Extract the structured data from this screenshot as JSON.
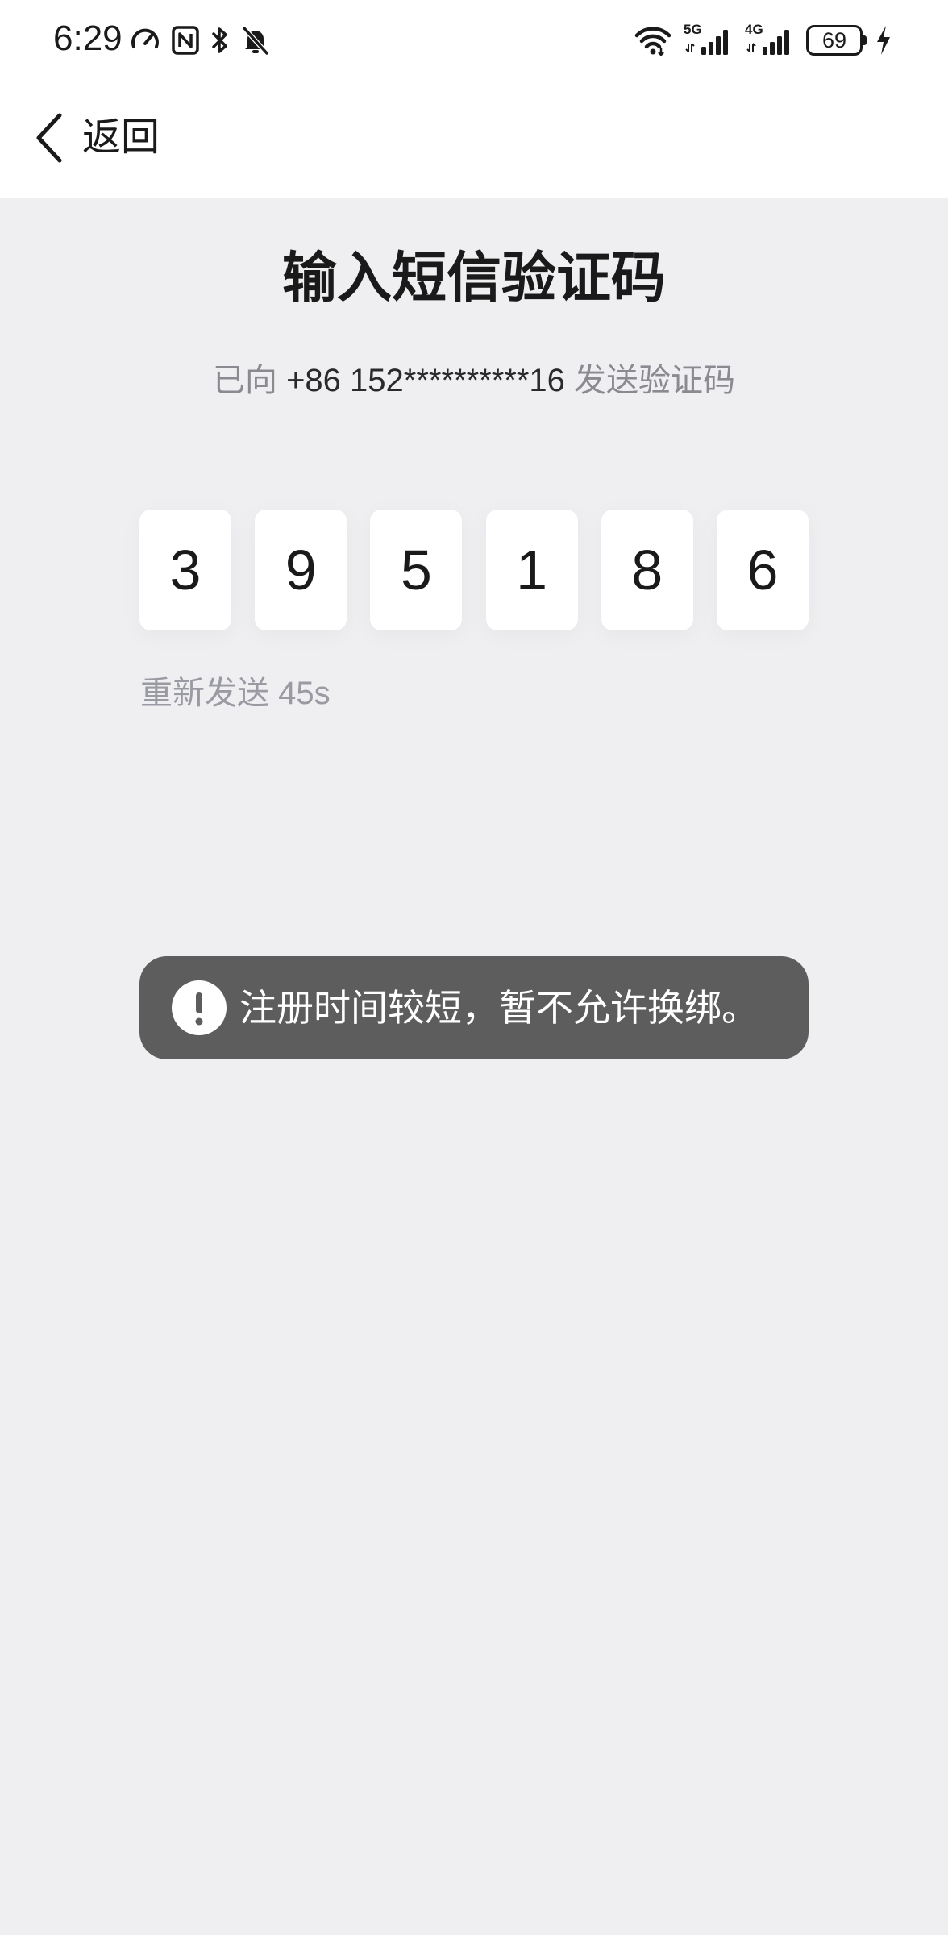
{
  "status_bar": {
    "time": "6:29",
    "network_5g": "5G",
    "network_4g": "4G",
    "battery": "69"
  },
  "nav": {
    "back_label": "返回"
  },
  "main": {
    "title": "输入短信验证码",
    "sent_prefix": "已向",
    "phone": "+86 152**********16",
    "sent_suffix": "发送验证码",
    "code_digits": [
      "3",
      "9",
      "5",
      "1",
      "8",
      "6"
    ],
    "resend_text": "重新发送 45s"
  },
  "toast": {
    "message": "注册时间较短，暂不允许换绑。"
  },
  "colors": {
    "background": "#efeff2",
    "toast_background": "#5d5d5d",
    "muted_text": "#8a8a90"
  }
}
